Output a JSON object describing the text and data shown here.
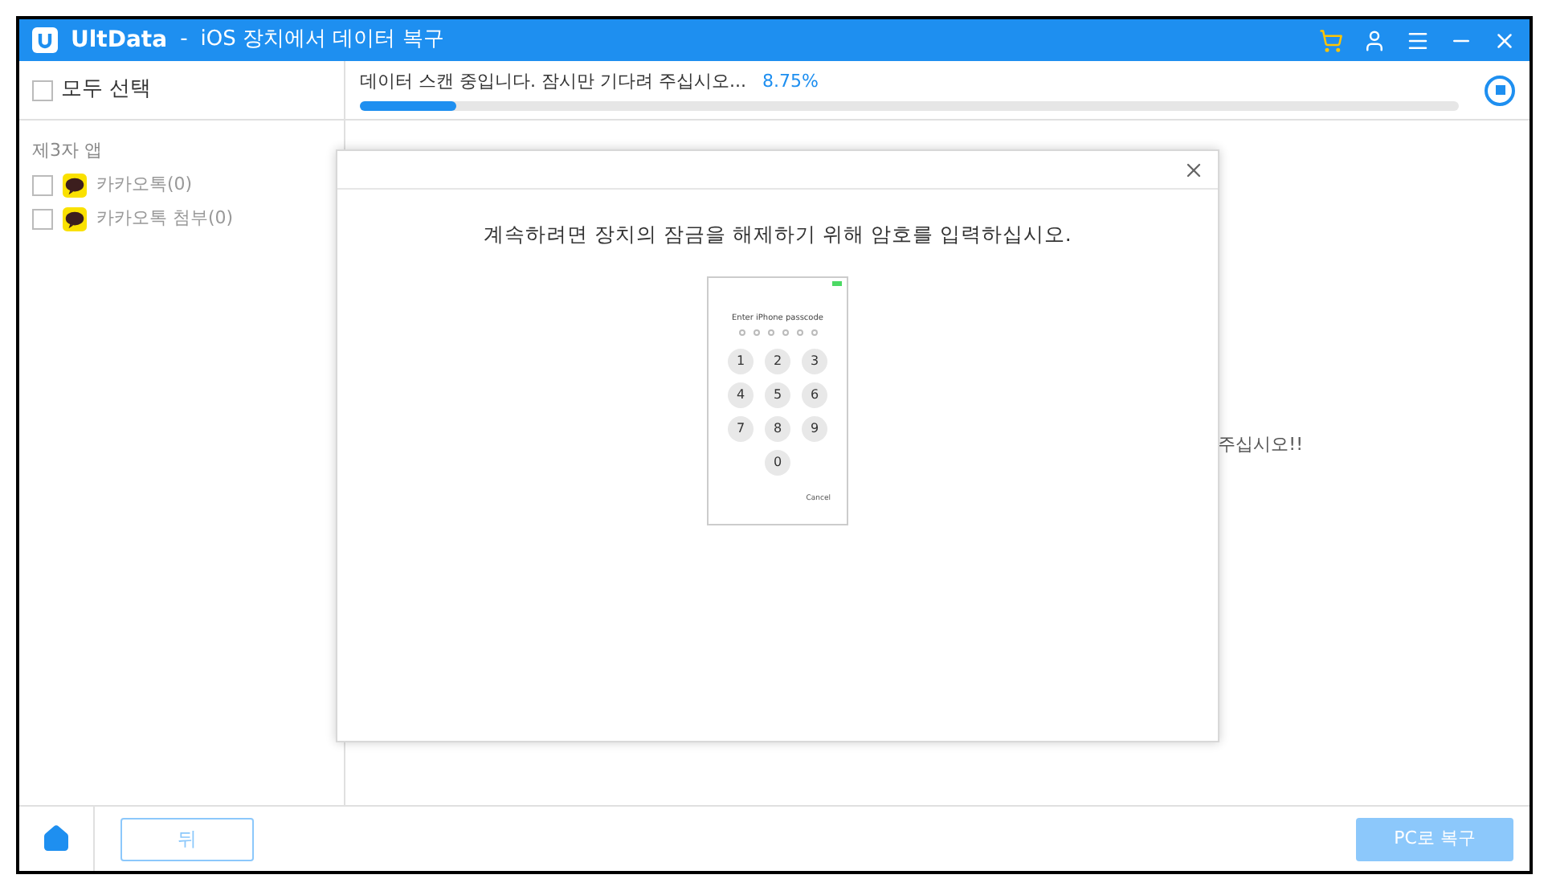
{
  "window": {
    "app_name": "UltData",
    "separator": "-",
    "title": "iOS 장치에서 데이터 복구"
  },
  "sidebar": {
    "select_all": {
      "label": "모두 선택",
      "checked": false
    },
    "section": "제3자 앱",
    "items": [
      {
        "label": "카카오톡(0)",
        "checked": false
      },
      {
        "label": "카카오톡 첨부(0)",
        "checked": false
      }
    ]
  },
  "progress": {
    "message": "데이터 스캔 중입니다. 잠시만 기다려 주십시오...",
    "percent": "8.75%",
    "level": 0.0875
  },
  "background_message": "주십시오!!",
  "dialog": {
    "message": "계속하려면 장치의 잠금을 해제하기 위해 암호를 입력하십시오.",
    "phone": {
      "prompt": "Enter iPhone passcode",
      "keys": [
        "1",
        "2",
        "3",
        "4",
        "5",
        "6",
        "7",
        "8",
        "9",
        "0"
      ],
      "cancel": "Cancel"
    }
  },
  "footer": {
    "back": "뒤",
    "recover": "PC로 복구",
    "recover_disabled": true
  }
}
